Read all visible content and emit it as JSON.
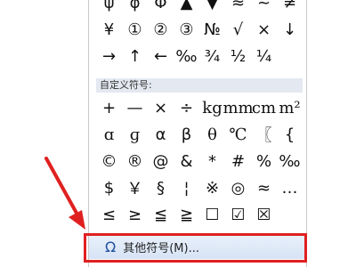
{
  "top_rows": [
    [
      "ψ",
      "φ",
      "Φ",
      "▲",
      "▼",
      "≈",
      "~",
      "≠"
    ],
    [
      "¥",
      "①",
      "②",
      "③",
      "№",
      "√",
      "×",
      "↓"
    ],
    [
      "→",
      "↑",
      "←",
      "‰",
      "¾",
      "½",
      "¼",
      ""
    ]
  ],
  "custom_section": {
    "header": "自定义符号:",
    "rows": [
      [
        "+",
        "—",
        "×",
        "÷",
        "kg",
        "mm",
        "cm",
        "m²"
      ],
      [
        "ɑ",
        "ɡ",
        "α",
        "β",
        "θ",
        "℃",
        "〖",
        "{"
      ],
      [
        "©",
        "®",
        "@",
        "&",
        "*",
        "#",
        "%",
        "‰"
      ],
      [
        "$",
        "￥",
        "§",
        "¦",
        "※",
        "◎",
        "≈",
        "…"
      ],
      [
        "≤",
        "≥",
        "≦",
        "≧",
        "☐",
        "☑",
        "☒",
        ""
      ]
    ]
  },
  "more_symbols": {
    "icon": "omega-icon",
    "label": "其他符号(M)..."
  },
  "annotation": {
    "arrow_color": "#e02020",
    "box_color": "#e02020"
  }
}
